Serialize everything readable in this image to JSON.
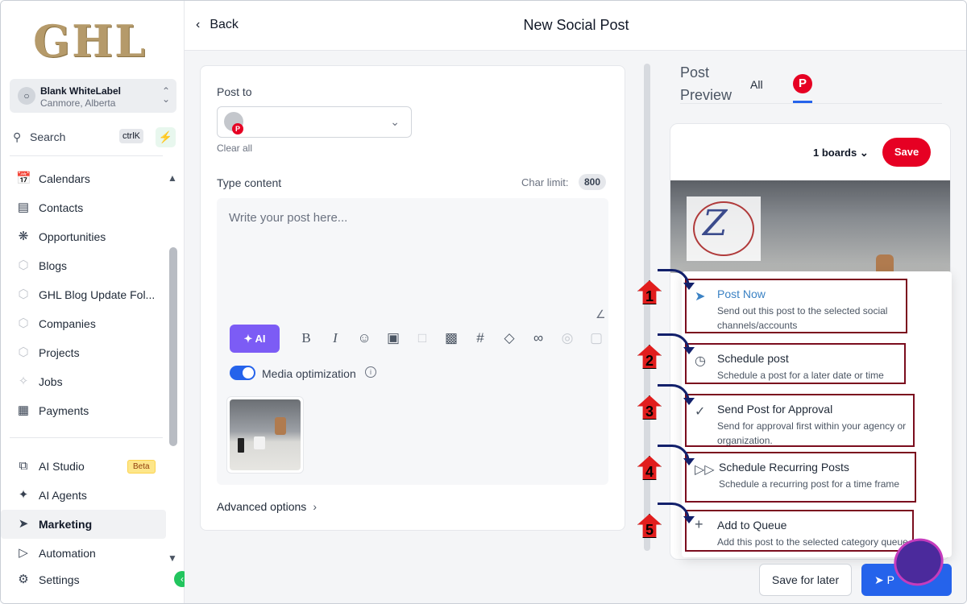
{
  "sidebar": {
    "logo": "GHL",
    "account": {
      "name": "Blank WhiteLabel",
      "location": "Canmore, Alberta"
    },
    "search": {
      "label": "Search",
      "shortcut": "ctrlK"
    },
    "items": [
      {
        "label": "Calendars",
        "icon": "calendar-icon"
      },
      {
        "label": "Contacts",
        "icon": "contacts-icon"
      },
      {
        "label": "Opportunities",
        "icon": "opportunities-icon"
      },
      {
        "label": "Blogs",
        "icon": "blogs-icon"
      },
      {
        "label": "GHL Blog Update Fol...",
        "icon": "cube-icon"
      },
      {
        "label": "Companies",
        "icon": "cube-icon"
      },
      {
        "label": "Projects",
        "icon": "cube-icon"
      },
      {
        "label": "Jobs",
        "icon": "jobs-icon"
      },
      {
        "label": "Payments",
        "icon": "payments-icon"
      }
    ],
    "bottom_items": [
      {
        "label": "AI Studio",
        "badge": "Beta",
        "icon": "ai-studio-icon"
      },
      {
        "label": "AI Agents",
        "icon": "sparkle-icon"
      },
      {
        "label": "Marketing",
        "icon": "send-icon"
      },
      {
        "label": "Automation",
        "icon": "automation-icon"
      },
      {
        "label": "Settings",
        "icon": "gear-icon"
      }
    ]
  },
  "header": {
    "back_label": "Back",
    "title": "New Social Post"
  },
  "composer": {
    "post_to_label": "Post to",
    "clear_all": "Clear all",
    "type_content_label": "Type content",
    "char_limit_label": "Char limit:",
    "char_limit_value": "800",
    "placeholder": "Write your post here...",
    "ai_label": "AI",
    "media_optimization_label": "Media optimization",
    "advanced_options": "Advanced options"
  },
  "preview": {
    "title_line1": "Post",
    "title_line2": "Preview",
    "tab_all": "All",
    "boards": "1 boards",
    "save": "Save"
  },
  "post_options": [
    {
      "num": "1",
      "title": "Post Now",
      "desc1": "Send out this post to the selected social",
      "desc2": "channels/accounts",
      "icon": "send-icon"
    },
    {
      "num": "2",
      "title": "Schedule post",
      "desc1": "Schedule a post for a later date or time",
      "desc2": "",
      "icon": "clock-icon"
    },
    {
      "num": "3",
      "title": "Send Post for Approval",
      "desc1": "Send for approval first within your agency or",
      "desc2": "organization.",
      "icon": "approval-badge-icon"
    },
    {
      "num": "4",
      "title": "Schedule Recurring Posts",
      "desc1": "Schedule a recurring post for a time frame",
      "desc2": "",
      "icon": "recurring-icon"
    },
    {
      "num": "5",
      "title": "Add to Queue",
      "desc1": "Add this post to the selected category queue",
      "desc2": "",
      "icon": "plus-icon"
    }
  ],
  "footer": {
    "save_for_later": "Save for later",
    "post_label": "P"
  },
  "colors": {
    "accent": "#2563eb",
    "pinterest": "#e60023",
    "ai": "#7c5cf5",
    "highlight_border": "#7b0d1e"
  }
}
